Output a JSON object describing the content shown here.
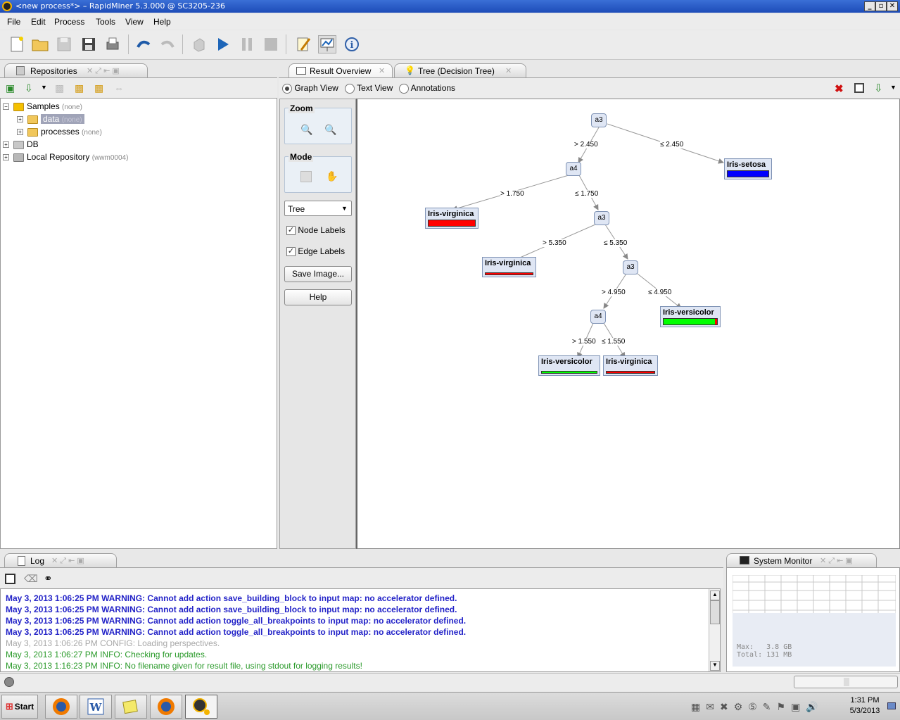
{
  "window": {
    "title": "<new process*> – RapidMiner 5.3.000 @ SC3205-236"
  },
  "menu": [
    "File",
    "Edit",
    "Process",
    "Tools",
    "View",
    "Help"
  ],
  "repositories": {
    "tab_label": "Repositories",
    "items": [
      {
        "label": "Samples",
        "sub": "(none)"
      },
      {
        "label": "data",
        "sub": "(none)"
      },
      {
        "label": "processes",
        "sub": "(none)"
      },
      {
        "label": "DB",
        "sub": ""
      },
      {
        "label": "Local Repository",
        "sub": "(wwm0004)"
      }
    ]
  },
  "result_tabs": [
    "Result Overview",
    "Tree (Decision Tree)"
  ],
  "view_modes": [
    "Graph View",
    "Text View",
    "Annotations"
  ],
  "selected_view_mode": "Graph View",
  "side_controls": {
    "zoom_label": "Zoom",
    "mode_label": "Mode",
    "layout_select": "Tree",
    "node_labels": "Node Labels",
    "node_labels_checked": true,
    "edge_labels": "Edge Labels",
    "edge_labels_checked": true,
    "save_image": "Save Image...",
    "help": "Help"
  },
  "tree": {
    "nodes": [
      "a3",
      "a4",
      "a3",
      "a3",
      "a4"
    ],
    "edges": [
      "> 2.450",
      "≤ 2.450",
      "> 1.750",
      "≤ 1.750",
      "> 5.350",
      "≤ 5.350",
      "> 4.950",
      "≤ 4.950",
      "> 1.550",
      "≤ 1.550"
    ],
    "leaves": [
      {
        "label": "Iris-setosa",
        "color": "#0000ff"
      },
      {
        "label": "Iris-virginica",
        "color": "#ff0000"
      },
      {
        "label": "Iris-virginica",
        "color": "#ff0000"
      },
      {
        "label": "Iris-versicolor",
        "color": "#00ff00"
      },
      {
        "label": "Iris-versicolor",
        "color": "#00ff00"
      },
      {
        "label": "Iris-virginica",
        "color": "#ff0000"
      }
    ]
  },
  "log": {
    "tab_label": "Log",
    "lines": [
      {
        "text": "May 3, 2013 1:06:25 PM WARNING: Cannot add action save_building_block to input map: no accelerator defined.",
        "level": "warn"
      },
      {
        "text": "May 3, 2013 1:06:25 PM WARNING: Cannot add action save_building_block to input map: no accelerator defined.",
        "level": "warn"
      },
      {
        "text": "May 3, 2013 1:06:25 PM WARNING: Cannot add action toggle_all_breakpoints to input map: no accelerator defined.",
        "level": "warn"
      },
      {
        "text": "May 3, 2013 1:06:25 PM WARNING: Cannot add action toggle_all_breakpoints to input map: no accelerator defined.",
        "level": "warn"
      },
      {
        "text": "May 3, 2013 1:06:26 PM CONFIG: Loading perspectives.",
        "level": "cfg"
      },
      {
        "text": "May 3, 2013 1:06:27 PM INFO: Checking for updates.",
        "level": "info"
      },
      {
        "text": "May 3, 2013 1:16:23 PM INFO: No filename given for result file, using stdout for logging results!",
        "level": "info"
      }
    ]
  },
  "system_monitor": {
    "tab_label": "System Monitor",
    "max": "Max:   3.8 GB",
    "total": "Total: 131 MB"
  },
  "taskbar": {
    "start": "Start",
    "time": "1:31 PM",
    "date": "5/3/2013"
  }
}
